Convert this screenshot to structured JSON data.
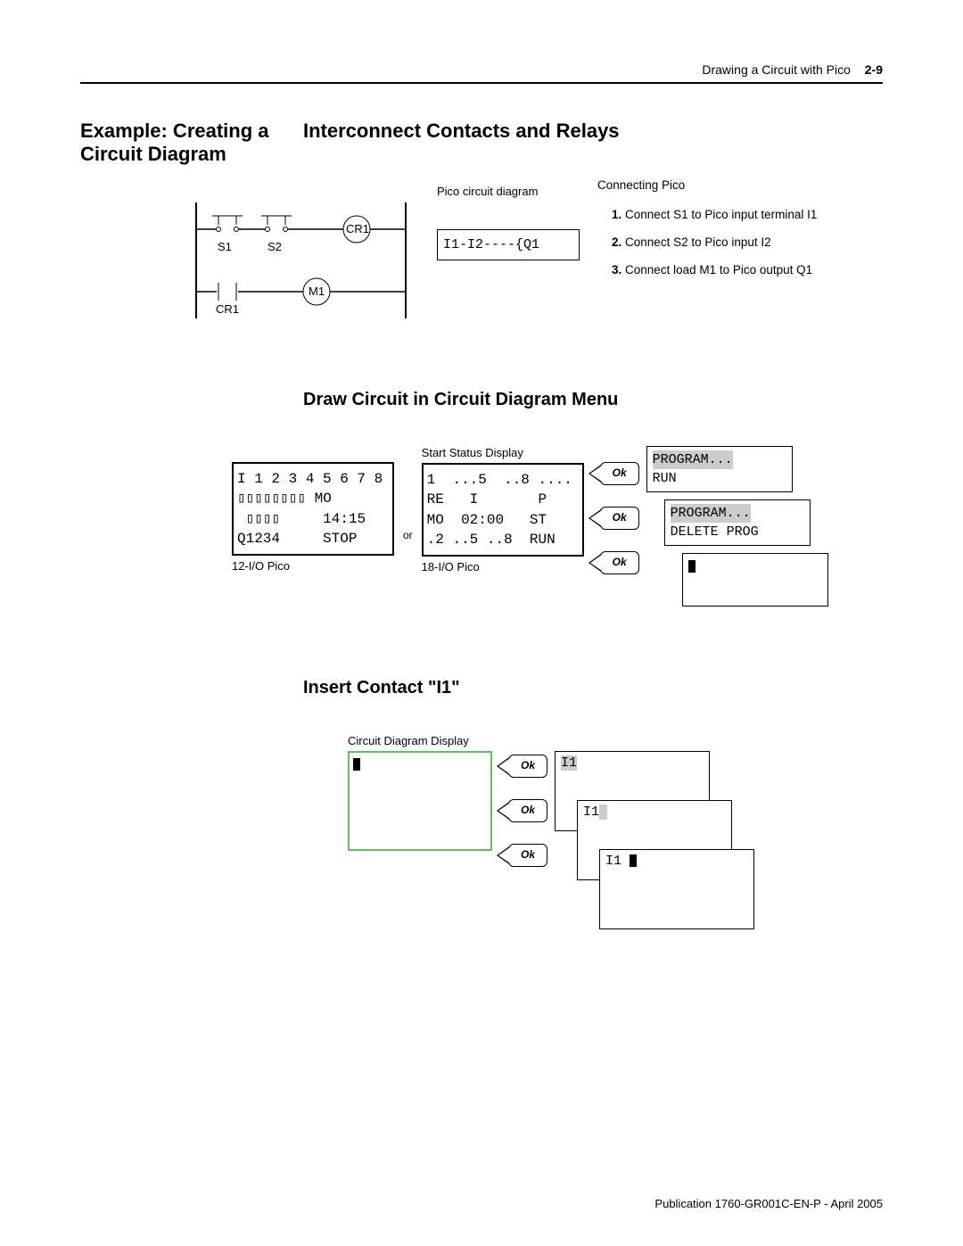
{
  "header": {
    "chapter": "Drawing a Circuit with Pico",
    "page": "2-9"
  },
  "titles": {
    "left": "Example: Creating a Circuit Diagram",
    "right": "Interconnect Contacts and Relays",
    "sub_draw": "Draw Circuit in Circuit Diagram Menu",
    "sub_insert": "Insert Contact \"I1\""
  },
  "schematic": {
    "s1": "S1",
    "s2": "S2",
    "cr1_top": "CR1",
    "cr1_bottom": "CR1",
    "m1": "M1"
  },
  "pico_diagram": {
    "label": "Pico circuit diagram",
    "box": "I1-I2----{Q1"
  },
  "connecting": {
    "title": "Connecting Pico",
    "items": [
      "Connect S1 to Pico input terminal I1",
      "Connect S2 to Pico input I2",
      "Connect load M1 to Pico output Q1"
    ]
  },
  "screens": {
    "start_status_label": "Start Status Display",
    "lcd_12io": "I 1 2 3 4 5 6 7 8\n▯▯▯▯▯▯▯▯ MO\n ▯▯▯▯     14:15\nQ1234     STOP",
    "lcd_12io_caption": "12-I/O Pico",
    "or": "or",
    "lcd_18io": "1  ...5  ..8 ....\nRE   I       P\nMO  02:00   ST\n.2 ..5 ..8  RUN",
    "lcd_18io_caption": "18-I/O Pico",
    "ok": "Ok",
    "menu1_line1": "PROGRAM...",
    "menu1_line2": "RUN",
    "menu2_line1": "PROGRAM...",
    "menu2_line2": "DELETE PROG"
  },
  "insert": {
    "caption": "Circuit Diagram Display",
    "i1": "I1"
  },
  "footer": "Publication 1760-GR001C-EN-P - April 2005"
}
